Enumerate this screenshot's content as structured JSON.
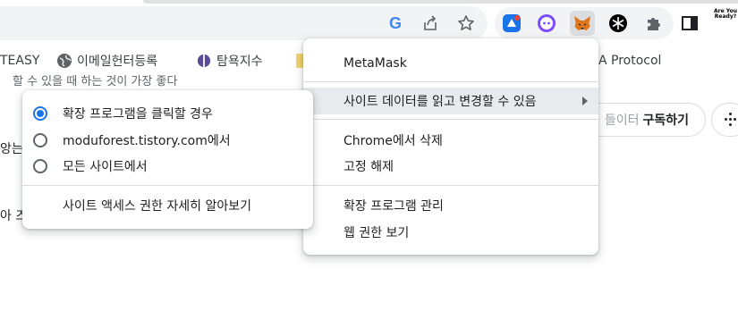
{
  "toolbar": {
    "google_letter": "G",
    "ares_text": "Are You Ready?",
    "icons": [
      "google-icon",
      "share-icon",
      "bookmark-star-icon",
      "kakao-extension-icon",
      "chatbot-extension-icon",
      "metamask-fox-icon",
      "openai-extension-icon",
      "puzzle-extensions-icon",
      "side-panel-icon",
      "are-you-ready-extension"
    ]
  },
  "bookmarks": {
    "items": [
      {
        "label": "TEASY",
        "icon": ""
      },
      {
        "label": "이메일헌터등록",
        "icon": "globe-icon"
      },
      {
        "label": "탐욕지수",
        "icon": "fear-greed-icon"
      },
      {
        "label": "A Protocol",
        "icon": ""
      }
    ]
  },
  "page": {
    "frag1": "할 수 있을 때 하는 것이 가장 좋다",
    "frag2": "앙는",
    "frag3": "아 즈",
    "subscribe_muted": "들이터",
    "subscribe_strong": "구독하기"
  },
  "main_menu": {
    "title": "MetaMask",
    "site_data": "사이트 데이터를 읽고 변경할 수 있음",
    "remove": "Chrome에서 삭제",
    "unpin": "고정 해제",
    "manage": "확장 프로그램 관리",
    "view_permissions": "웹 권한 보기"
  },
  "sub_menu": {
    "on_click": "확장 프로그램을 클릭할 경우",
    "on_site": "moduforest.tistory.com에서",
    "all_sites": "모든 사이트에서",
    "learn_more": "사이트 액세스 권한 자세히 알아보기",
    "selected": "on_click"
  },
  "colors": {
    "accent": "#1a73e8",
    "menu_highlight": "#e8eaed",
    "metamask_orange": "#e2761b"
  }
}
